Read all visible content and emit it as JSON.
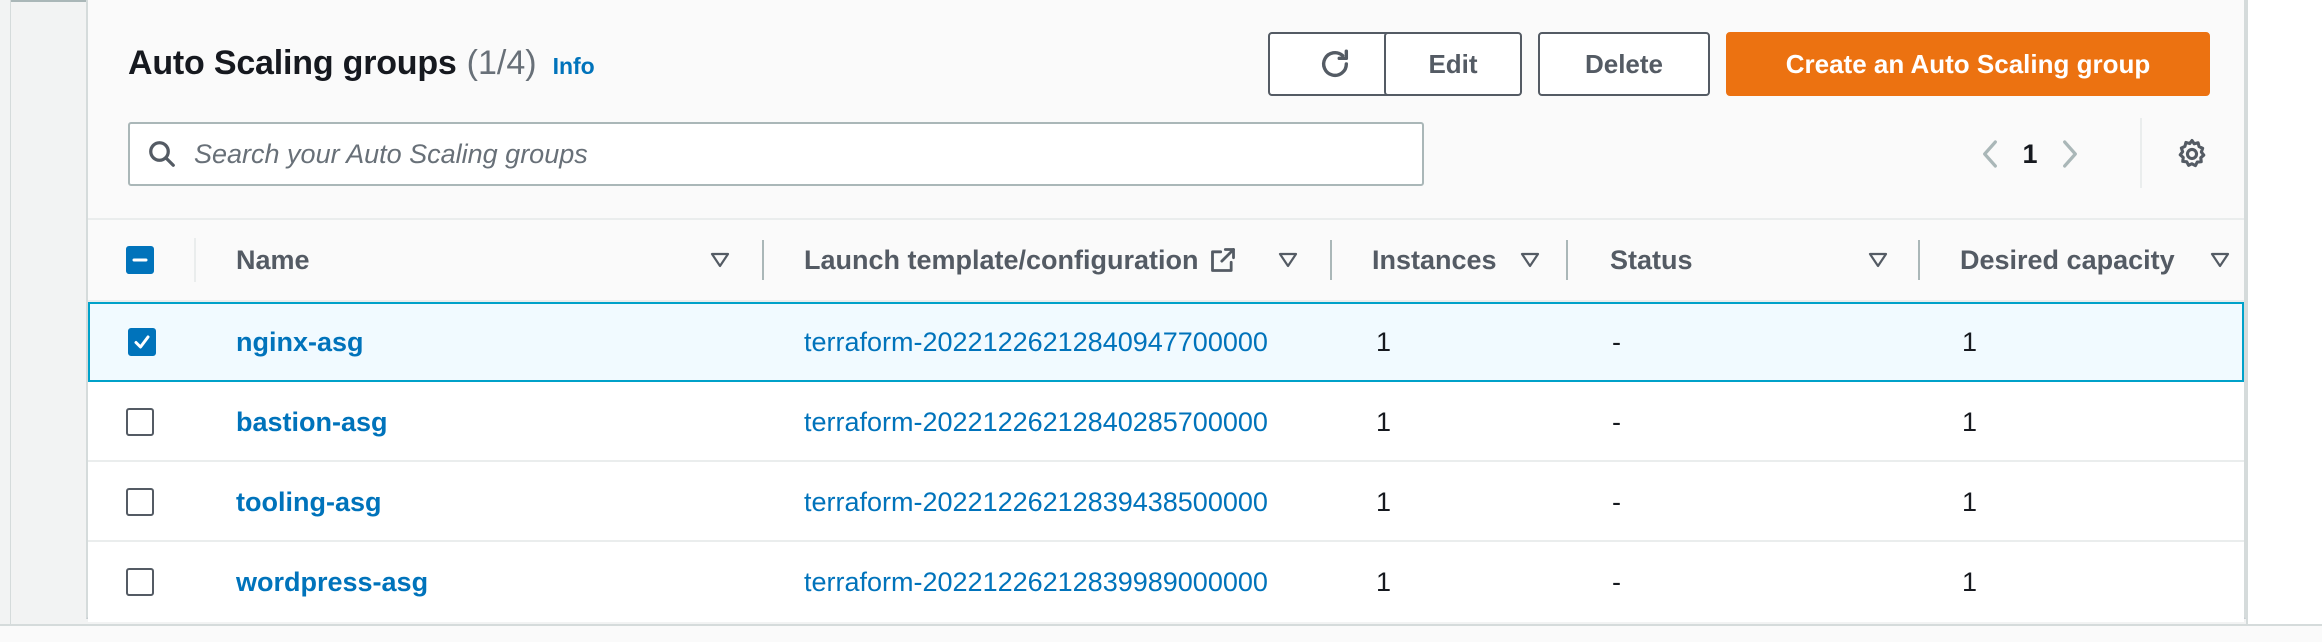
{
  "header": {
    "title": "Auto Scaling groups",
    "count": "(1/4)",
    "info_label": "Info"
  },
  "actions": {
    "edit_label": "Edit",
    "delete_label": "Delete",
    "create_label": "Create an Auto Scaling group"
  },
  "search": {
    "placeholder": "Search your Auto Scaling groups",
    "value": ""
  },
  "pagination": {
    "current_page": "1"
  },
  "table": {
    "columns": {
      "name": "Name",
      "launch_template": "Launch template/configuration",
      "instances": "Instances",
      "status": "Status",
      "desired_capacity": "Desired capacity"
    },
    "rows": [
      {
        "name": "nginx-asg",
        "launch_template": "terraform-20221226212840947700000",
        "instances": "1",
        "status": "-",
        "desired_capacity": "1",
        "selected": true
      },
      {
        "name": "bastion-asg",
        "launch_template": "terraform-20221226212840285700000",
        "instances": "1",
        "status": "-",
        "desired_capacity": "1",
        "selected": false
      },
      {
        "name": "tooling-asg",
        "launch_template": "terraform-20221226212839438500000",
        "instances": "1",
        "status": "-",
        "desired_capacity": "1",
        "selected": false
      },
      {
        "name": "wordpress-asg",
        "launch_template": "terraform-20221226212839989000000",
        "instances": "1",
        "status": "-",
        "desired_capacity": "1",
        "selected": false
      }
    ]
  },
  "colors": {
    "primary": "#ec7211",
    "link": "#0073bb",
    "selected_row_bg": "#f1faff",
    "selected_row_border": "#00a1c9"
  },
  "icons": {
    "refresh": "refresh-icon",
    "search": "search-icon",
    "prev": "chevron-left-icon",
    "next": "chevron-right-icon",
    "settings": "gear-icon",
    "external": "external-link-icon",
    "sort": "sort-down-icon"
  }
}
